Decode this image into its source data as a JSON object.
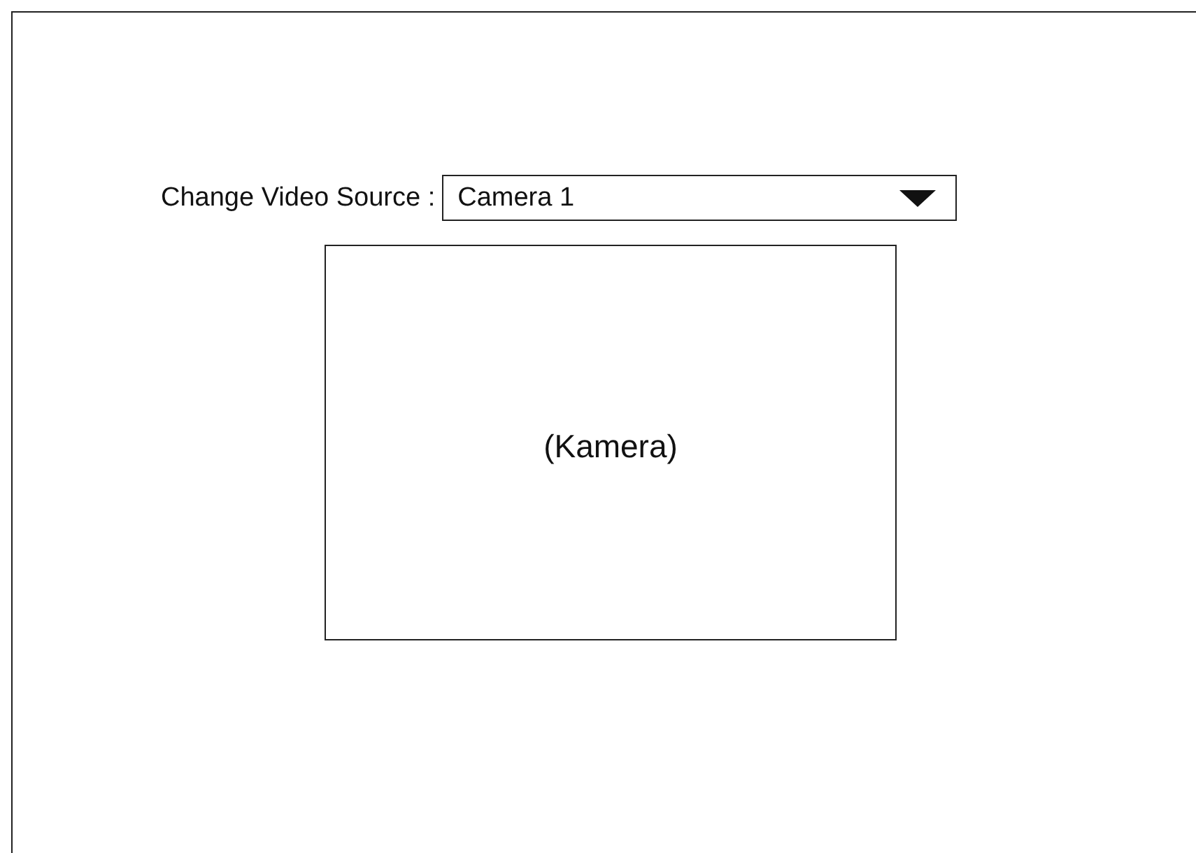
{
  "video_source": {
    "label": "Change Video Source :",
    "value": "Camera 1"
  },
  "video_panel": {
    "text": "(Kamera)"
  }
}
